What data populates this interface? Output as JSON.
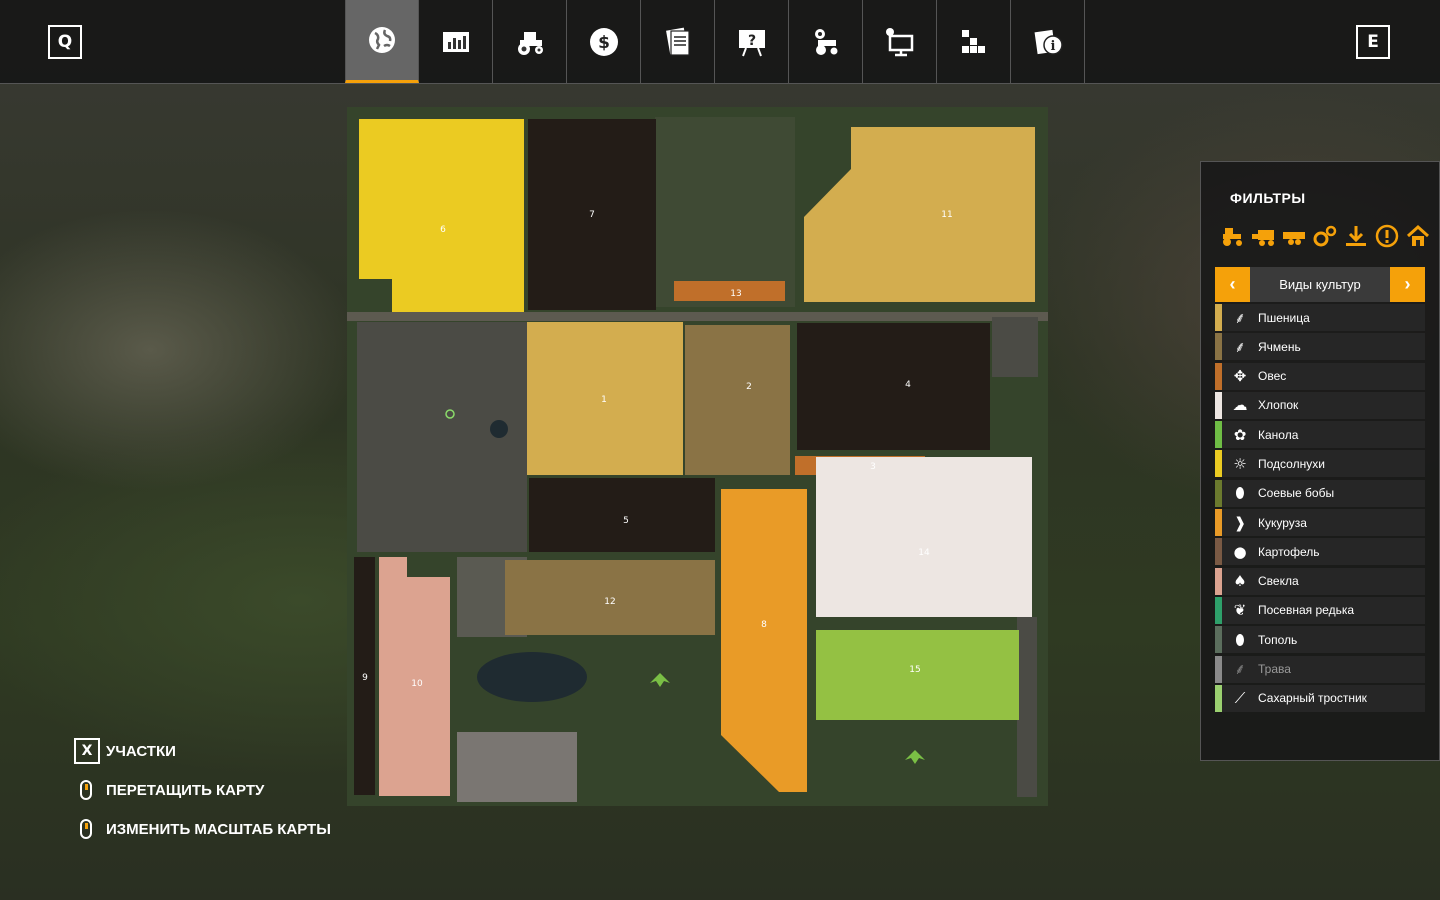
{
  "topbar": {
    "left_key": "Q",
    "right_key": "E",
    "tabs": [
      {
        "icon": "globe-icon"
      },
      {
        "icon": "stats-chart-icon"
      },
      {
        "icon": "tractor-icon"
      },
      {
        "icon": "dollar-icon"
      },
      {
        "icon": "contracts-icon"
      },
      {
        "icon": "help-presentation-icon"
      },
      {
        "icon": "tractor-gear-icon"
      },
      {
        "icon": "settings-monitor-icon"
      },
      {
        "icon": "blocks-icon"
      },
      {
        "icon": "info-icon"
      }
    ]
  },
  "map": {
    "fields": [
      {
        "id": "6",
        "label": "6",
        "color": "#ebcb22"
      },
      {
        "id": "7",
        "label": "7",
        "color": "#231c17"
      },
      {
        "id": "13",
        "label": "13",
        "color": "#c06f2a"
      },
      {
        "id": "11",
        "label": "11",
        "color": "#d3ad4f"
      },
      {
        "id": "1",
        "label": "1",
        "color": "#d3ad4f"
      },
      {
        "id": "2",
        "label": "2",
        "color": "#8a7345"
      },
      {
        "id": "4",
        "label": "4",
        "color": "#231c17"
      },
      {
        "id": "3",
        "label": "3",
        "color": "#c06f2a"
      },
      {
        "id": "5",
        "label": "5",
        "color": "#231c17"
      },
      {
        "id": "14",
        "label": "14",
        "color": "#ede6e2"
      },
      {
        "id": "8",
        "label": "8",
        "color": "#e99b27"
      },
      {
        "id": "12",
        "label": "12",
        "color": "#8a7345"
      },
      {
        "id": "15",
        "label": "15",
        "color": "#94c143"
      },
      {
        "id": "9",
        "label": "9",
        "color": "#231c17"
      },
      {
        "id": "10",
        "label": "10",
        "color": "#dca390"
      }
    ]
  },
  "legend": {
    "items": [
      {
        "key": "X",
        "label": "УЧАСТКИ"
      },
      {
        "key": "mouse",
        "label": "ПЕРЕТАЩИТЬ КАРТУ"
      },
      {
        "key": "mouse",
        "label": "ИЗМЕНИТЬ МАСШТАБ КАРТЫ"
      }
    ]
  },
  "filters": {
    "title": "ФИЛЬТРЫ",
    "filter_icons": [
      "tractor-icon",
      "harvester-icon",
      "trailer-icon",
      "tools-gear-icon",
      "download-icon",
      "alert-icon",
      "home-icon"
    ],
    "selector": {
      "prev": "‹",
      "label": "Виды культур",
      "next": "›"
    },
    "crops": [
      {
        "label": "Пшеница",
        "color": "#d3ad4f",
        "icon": "wheat-icon"
      },
      {
        "label": "Ячмень",
        "color": "#8a7345",
        "icon": "barley-icon"
      },
      {
        "label": "Овес",
        "color": "#c06f2a",
        "icon": "oat-icon"
      },
      {
        "label": "Хлопок",
        "color": "#ede6e2",
        "icon": "cotton-icon"
      },
      {
        "label": "Канола",
        "color": "#6fbd45",
        "icon": "canola-icon"
      },
      {
        "label": "Подсолнухи",
        "color": "#ebcb22",
        "icon": "sunflower-icon"
      },
      {
        "label": "Соевые бобы",
        "color": "#6b7a2e",
        "icon": "soybean-icon"
      },
      {
        "label": "Кукуруза",
        "color": "#e99b27",
        "icon": "corn-icon"
      },
      {
        "label": "Картофель",
        "color": "#7a5a44",
        "icon": "potato-icon"
      },
      {
        "label": "Свекла",
        "color": "#dca390",
        "icon": "beet-icon"
      },
      {
        "label": "Посевная редька",
        "color": "#2ea06a",
        "icon": "radish-icon"
      },
      {
        "label": "Тополь",
        "color": "#5b6e5d",
        "icon": "poplar-icon"
      },
      {
        "label": "Трава",
        "color": "#8a8a8a",
        "icon": "grass-icon",
        "dim": true
      },
      {
        "label": "Сахарный тростник",
        "color": "#9bd070",
        "icon": "sugarcane-icon"
      }
    ]
  }
}
